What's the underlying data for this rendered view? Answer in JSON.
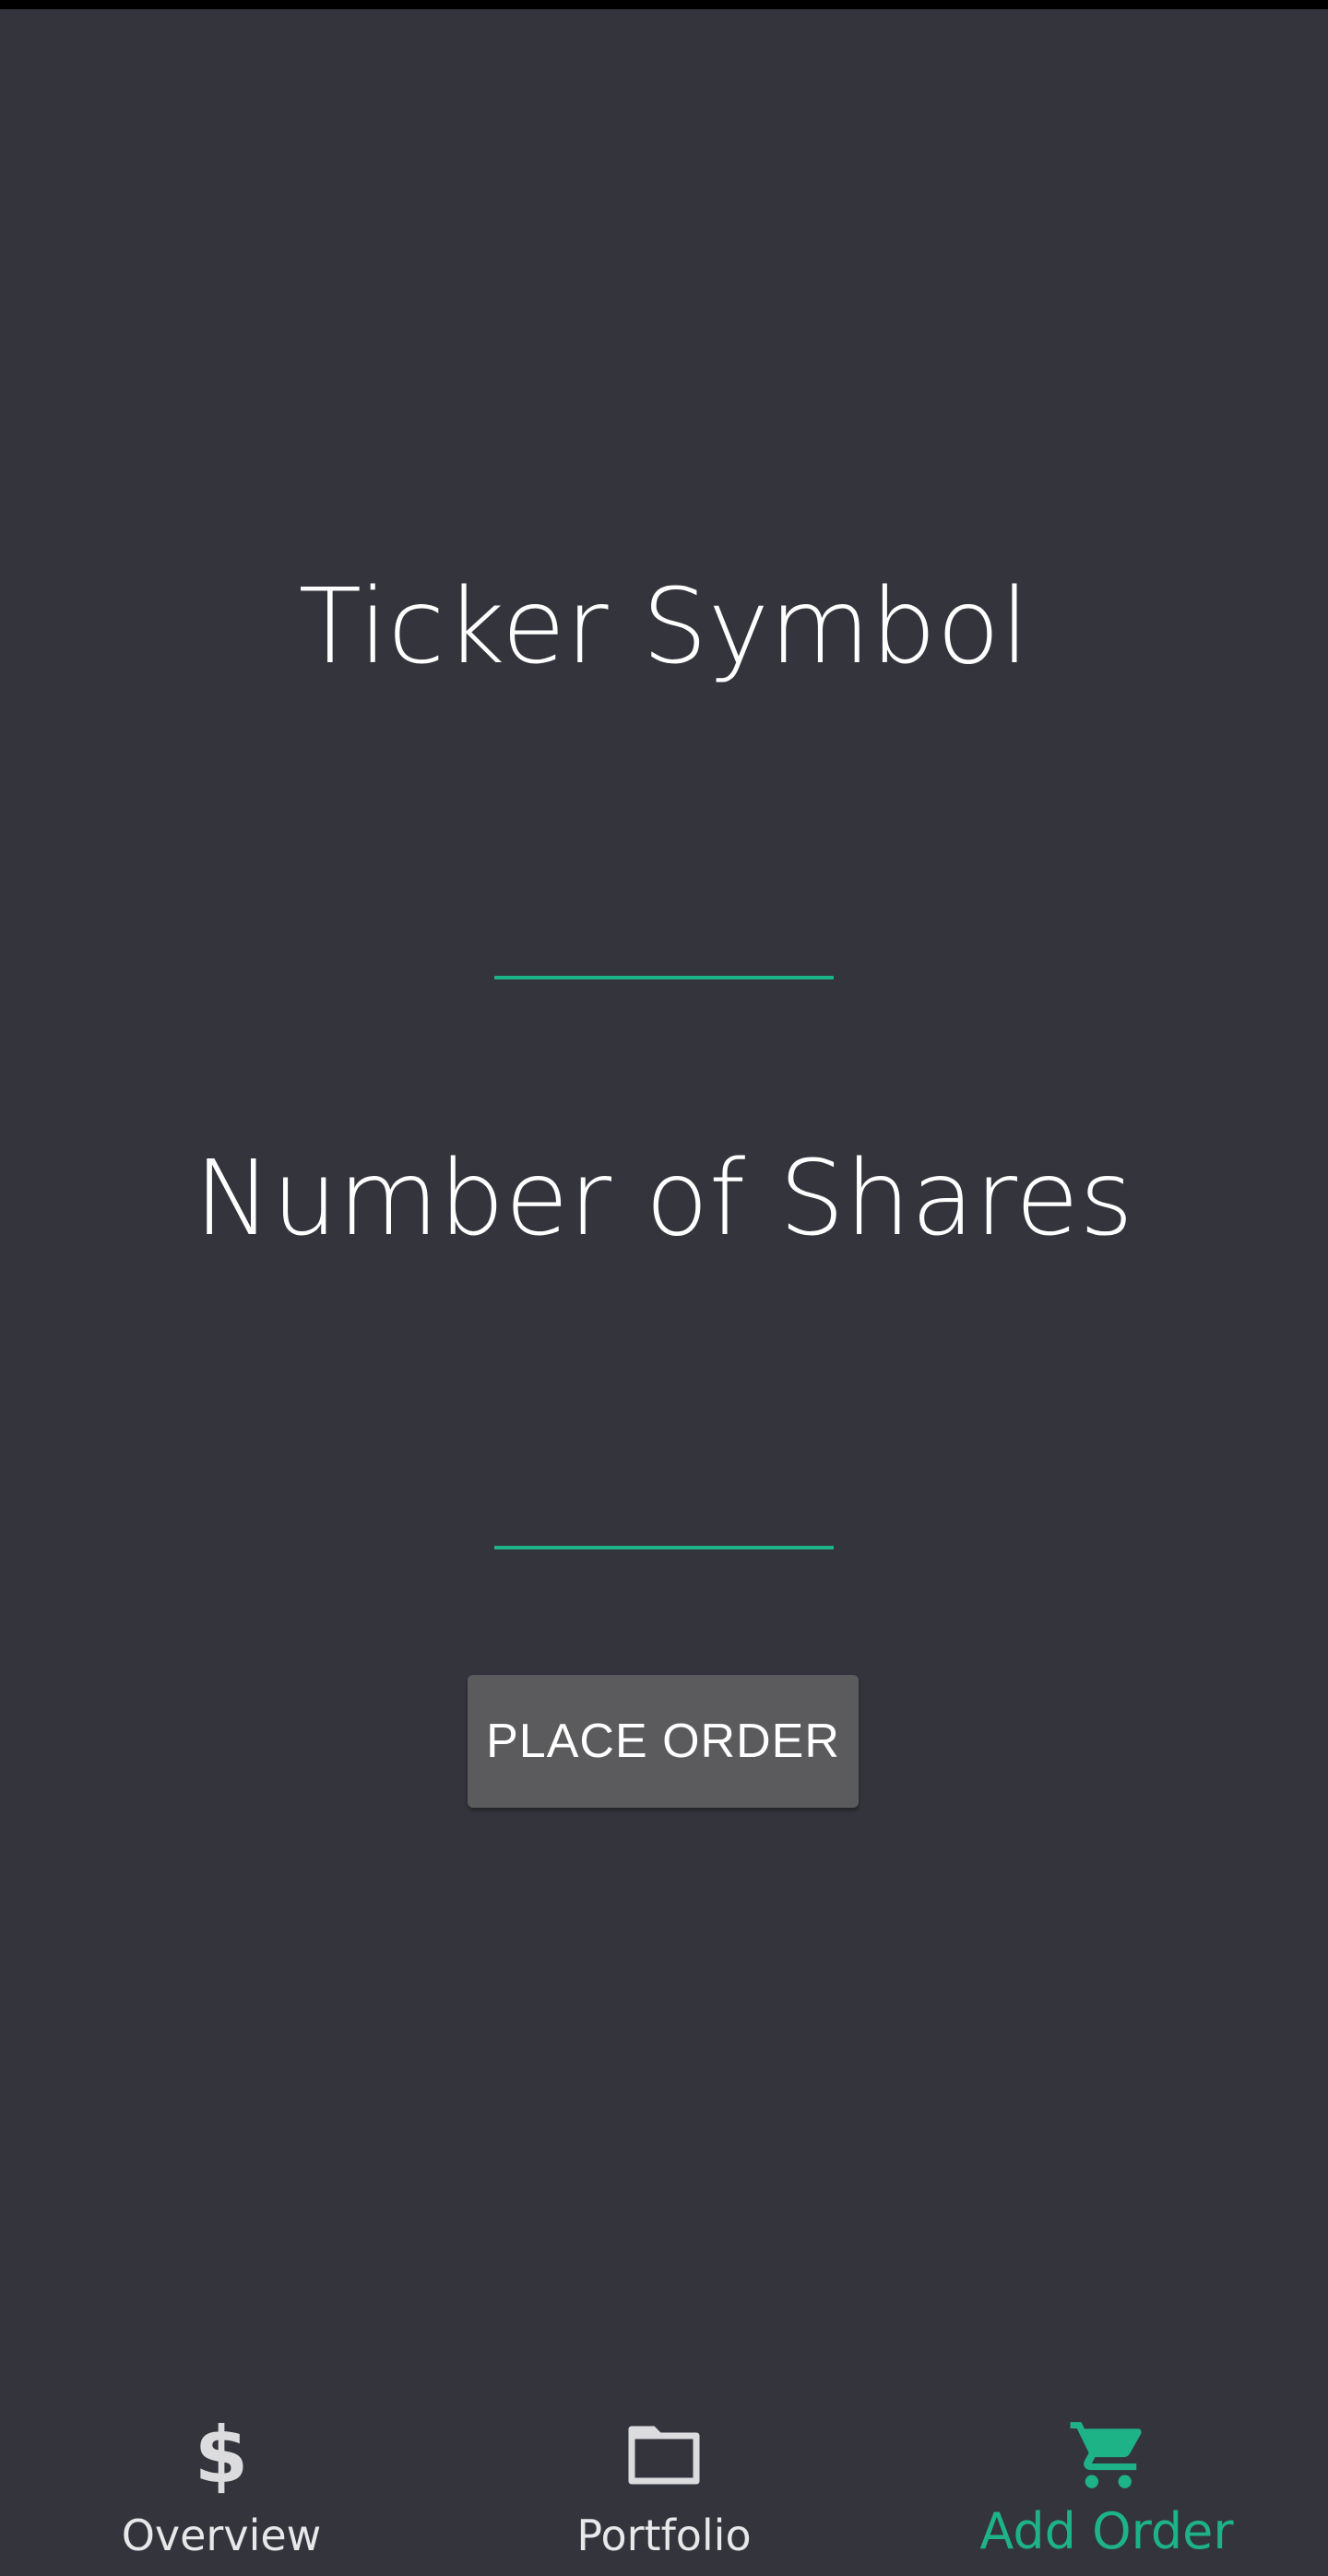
{
  "form": {
    "ticker_label": "Ticker Symbol",
    "ticker_value": "",
    "shares_label": "Number of Shares",
    "shares_value": "",
    "submit_label": "PLACE ORDER"
  },
  "bottom_nav": {
    "items": [
      {
        "label": "Overview",
        "icon": "dollar-icon",
        "active": false
      },
      {
        "label": "Portfolio",
        "icon": "folder-icon",
        "active": false
      },
      {
        "label": "Add Order",
        "icon": "cart-icon",
        "active": true
      }
    ]
  },
  "colors": {
    "background": "#34343d",
    "accent": "#1db386",
    "button": "#5b5b5e",
    "inactive_icon": "#dcdcde"
  }
}
